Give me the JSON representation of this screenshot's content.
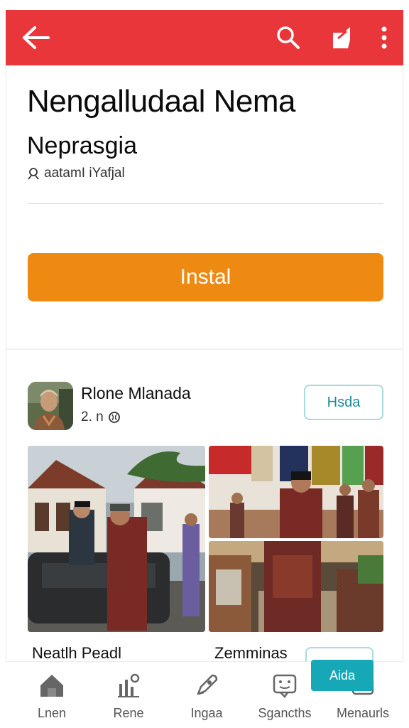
{
  "appbar": {
    "color": "#e8363b",
    "icons": [
      "arrow-back-icon",
      "search-icon",
      "share-icon",
      "more-vert-icon"
    ]
  },
  "app": {
    "title": "Nengalludaal Nema",
    "subtitle": "Neprasgia",
    "meta_text": "aatamI iYafjal",
    "install_label": "Instal",
    "install_color": "#ee8a12"
  },
  "developer": {
    "name": "Rlone Mlanada",
    "meta_text": "2. n",
    "follow_label": "Hsda"
  },
  "cards": {
    "left_title": "Neatlh Peadl",
    "right_title": "Zemminas"
  },
  "bottom_nav": {
    "items": [
      {
        "label": "Lnen",
        "icon": "home-icon"
      },
      {
        "label": "Rene",
        "icon": "stats-icon"
      },
      {
        "label": "Ingaa",
        "icon": "pen-icon"
      },
      {
        "label": "Sgancths",
        "icon": "chat-icon"
      },
      {
        "label": "Menaurls",
        "icon": "menu-icon"
      }
    ],
    "fab_label": "Aida"
  }
}
